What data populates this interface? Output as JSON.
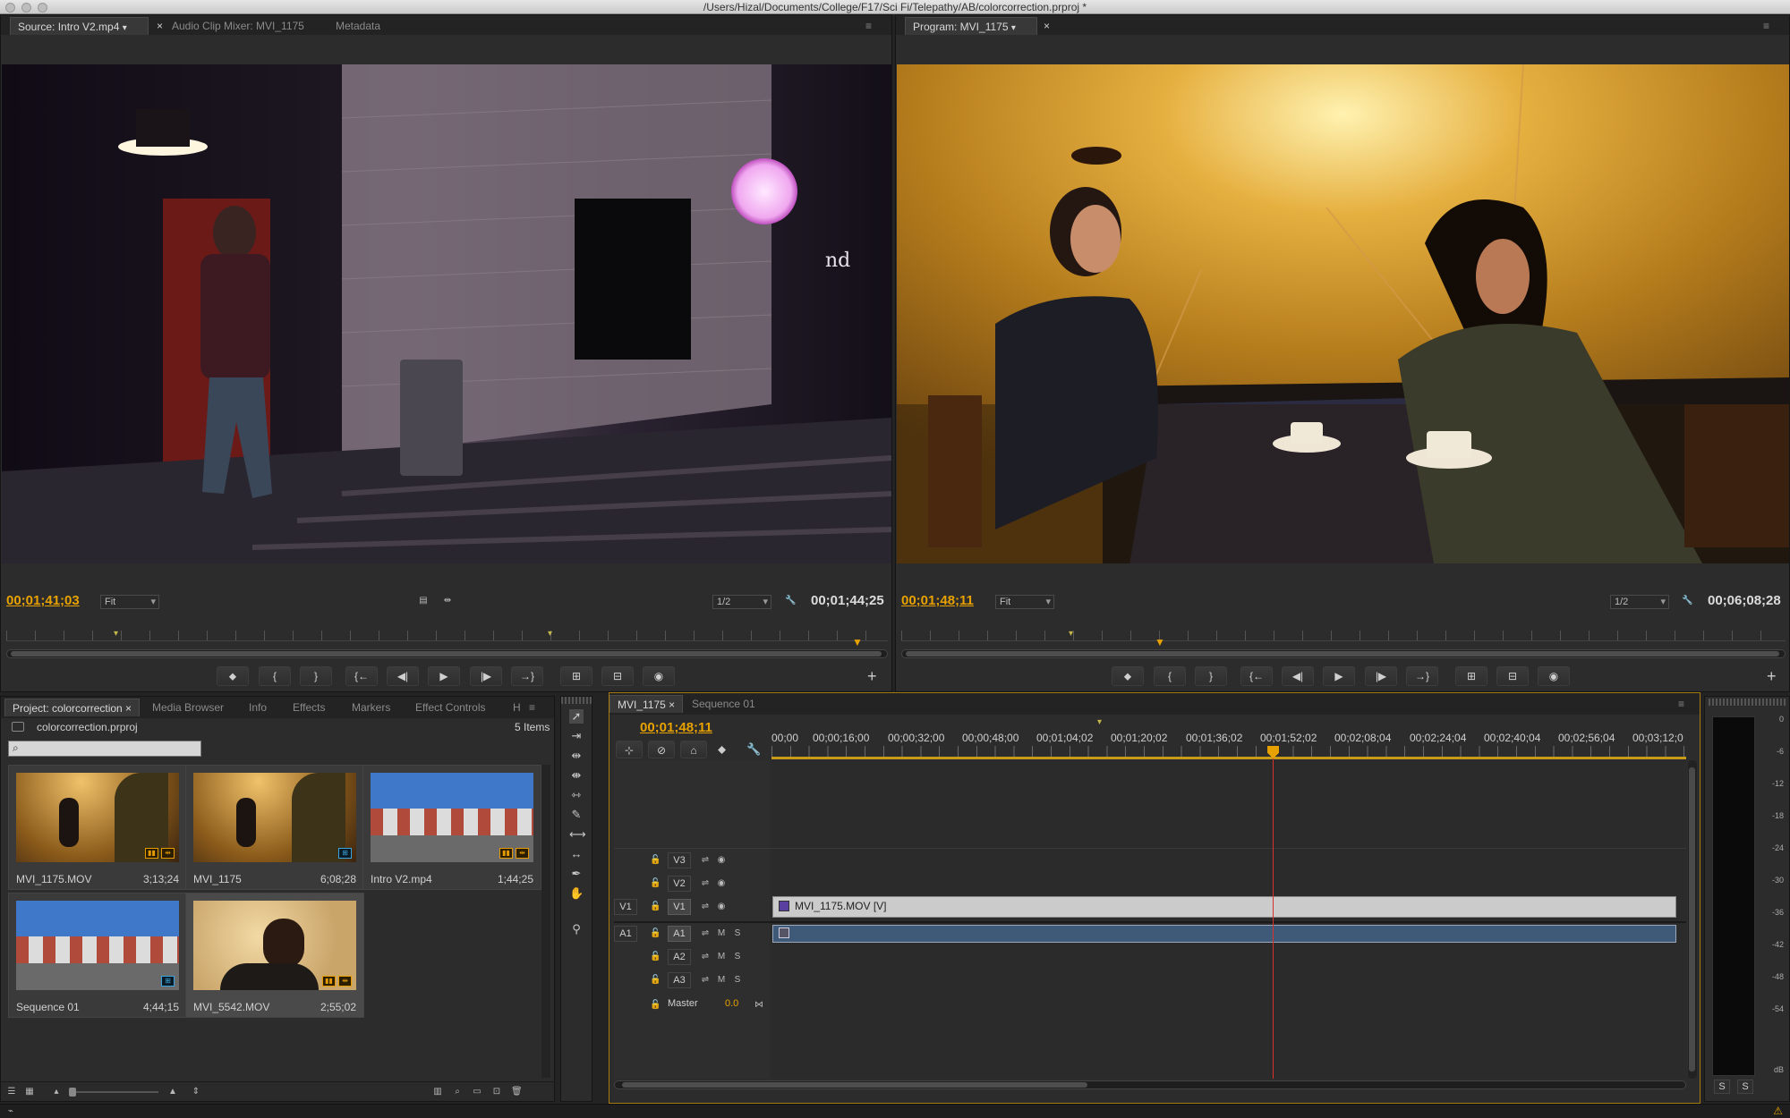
{
  "window": {
    "title": "/Users/Hizal/Documents/College/F17/Sci Fi/Telepathy/AB/colorcorrection.prproj *"
  },
  "source": {
    "tabs": [
      "Source: Intro V2.mp4",
      "Audio Clip Mixer: MVI_1175",
      "Metadata"
    ],
    "timecode": "00;01;41;03",
    "fit": "Fit",
    "resolution": "1/2",
    "duration": "00;01;44;25"
  },
  "program": {
    "tab": "Program: MVI_1175",
    "timecode": "00;01;48;11",
    "fit": "Fit",
    "resolution": "1/2",
    "duration": "00;06;08;28"
  },
  "project": {
    "tabs": [
      "Project: colorcorrection",
      "Media Browser",
      "Info",
      "Effects",
      "Markers",
      "Effect Controls",
      "H"
    ],
    "filename": "colorcorrection.prproj",
    "item_count": "5 Items",
    "items": [
      {
        "name": "MVI_1175.MOV",
        "duration": "3;13;24",
        "thumb": "cafe"
      },
      {
        "name": "MVI_1175",
        "duration": "6;08;28",
        "thumb": "cafe"
      },
      {
        "name": "Intro V2.mp4",
        "duration": "1;44;25",
        "thumb": "campus"
      },
      {
        "name": "Sequence 01",
        "duration": "4;44;15",
        "thumb": "campus"
      },
      {
        "name": "MVI_5542.MOV",
        "duration": "2;55;02",
        "thumb": "portrait"
      }
    ]
  },
  "timeline": {
    "tabs": [
      "MVI_1175",
      "Sequence 01"
    ],
    "timecode": "00;01;48;11",
    "ruler": [
      "00;00",
      "00;00;16;00",
      "00;00;32;00",
      "00;00;48;00",
      "00;01;04;02",
      "00;01;20;02",
      "00;01;36;02",
      "00;01;52;02",
      "00;02;08;04",
      "00;02;24;04",
      "00;02;40;04",
      "00;02;56;04",
      "00;03;12;0"
    ],
    "video_tracks": [
      "V3",
      "V2",
      "V1"
    ],
    "audio_tracks": [
      "A1",
      "A2",
      "A3"
    ],
    "source_v": "V1",
    "source_a": "A1",
    "master_label": "Master",
    "master_value": "0.0",
    "mute": "M",
    "solo": "S",
    "clip_video": "MVI_1175.MOV [V]",
    "playhead_fraction": 0.548
  },
  "meter": {
    "labels": [
      "0",
      "-6",
      "-12",
      "-18",
      "-24",
      "-30",
      "-36",
      "-42",
      "-48",
      "-54",
      "dB"
    ],
    "buttons": [
      "S",
      "S"
    ]
  },
  "colors": {
    "accent": "#e8a200",
    "playhead": "#d8322a",
    "clip_video": "#c8c8c8",
    "clip_audio": "#3f5a78"
  },
  "icons": [
    "selection-tool",
    "track-select-tool",
    "ripple-edit-tool",
    "rolling-edit-tool",
    "rate-stretch-tool",
    "razor-tool",
    "slip-tool",
    "slide-tool",
    "pen-tool",
    "hand-tool",
    "zoom-tool",
    "marker-icon",
    "wrench-icon",
    "camera-icon",
    "plus-icon",
    "search-icon"
  ]
}
